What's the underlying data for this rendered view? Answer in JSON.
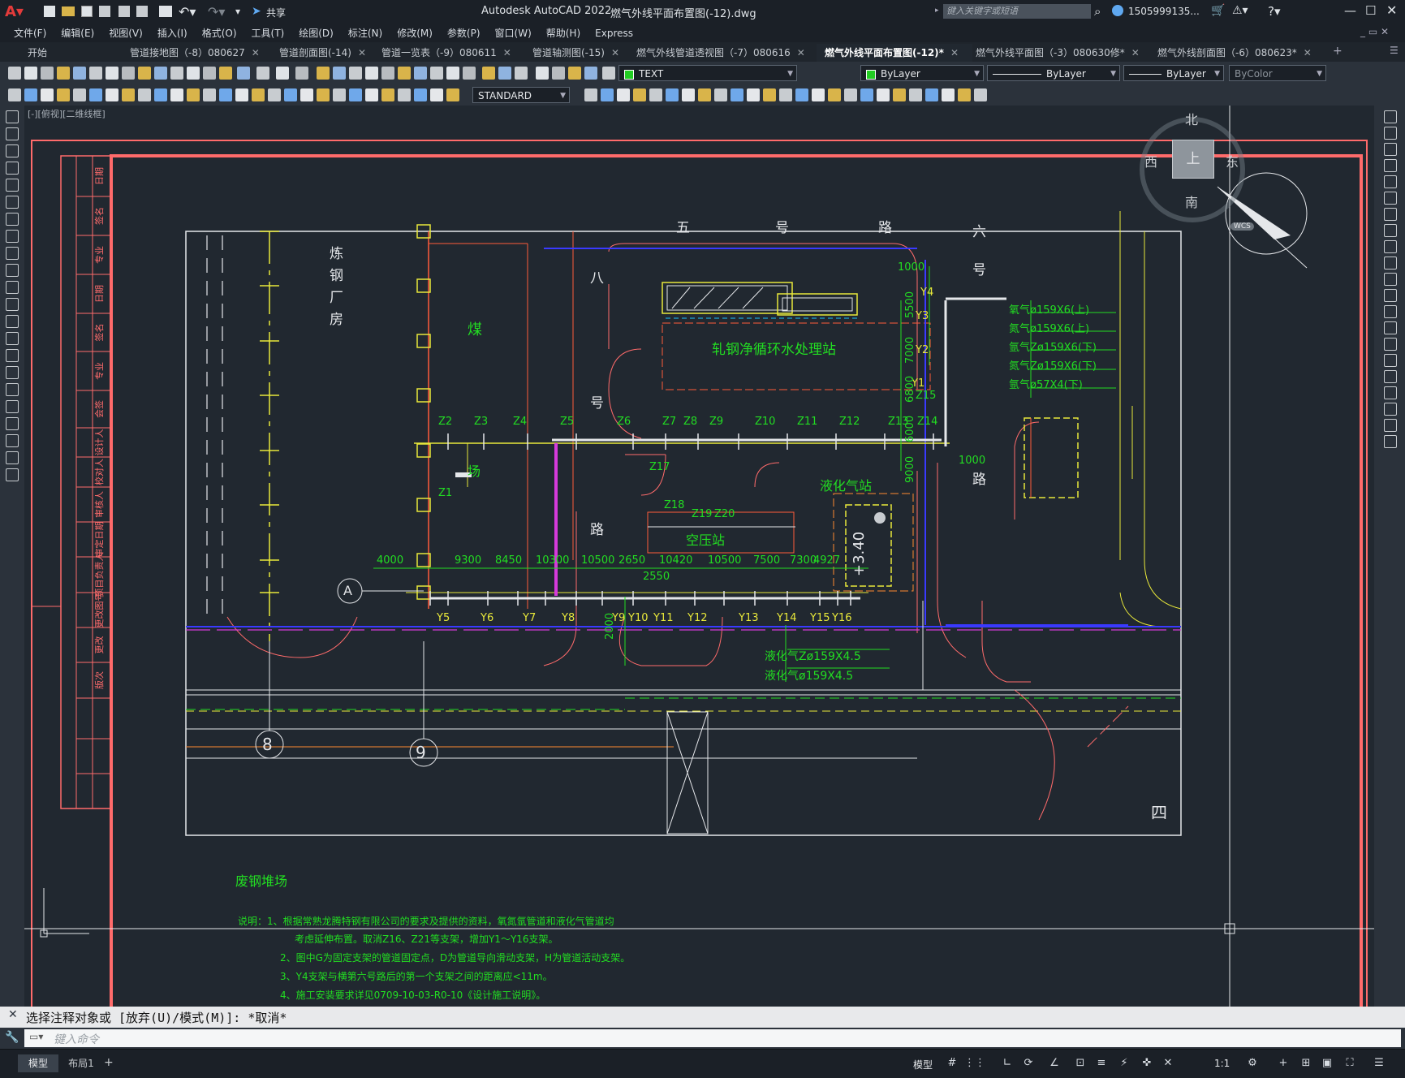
{
  "app": {
    "title": "Autodesk AutoCAD 2022",
    "file": "燃气外线平面布置图(-12).dwg",
    "search_placeholder": "键入关键字或短语",
    "user": "1505999135...",
    "share": "共享"
  },
  "menu": [
    "文件(F)",
    "编辑(E)",
    "视图(V)",
    "插入(I)",
    "格式(O)",
    "工具(T)",
    "绘图(D)",
    "标注(N)",
    "修改(M)",
    "参数(P)",
    "窗口(W)",
    "帮助(H)",
    "Express"
  ],
  "tabs": [
    {
      "label": "开始"
    },
    {
      "label": "管道接地图（-8）080627"
    },
    {
      "label": "管道剖面图(-14)"
    },
    {
      "label": "管道一览表（-9）080611"
    },
    {
      "label": "管道轴测图(-15)"
    },
    {
      "label": "燃气外线管道透视图（-7）080616"
    },
    {
      "label": "燃气外线平面布置图(-12)*"
    },
    {
      "label": "燃气外线平面图（-3）080630修*"
    },
    {
      "label": "燃气外线剖面图（-6）080623*"
    }
  ],
  "toolbar": {
    "layer": "TEXT",
    "color": "ByLayer",
    "linetype": "ByLayer",
    "lineweight": "ByLayer",
    "plotstyle": "ByColor",
    "textstyle": "STANDARD"
  },
  "viewport_label": "[-][俯视][二维线框]",
  "viewcube": {
    "north": "北",
    "south": "南",
    "east": "东",
    "west": "西",
    "top": "上",
    "wcs": "WCS"
  },
  "drawing": {
    "road_5": [
      "五",
      "号",
      "路"
    ],
    "road_6": [
      "六",
      "号",
      "路"
    ],
    "road_8": [
      "八",
      "号",
      "路"
    ],
    "road_4": "四",
    "building_steel": [
      "炼",
      "钢",
      "厂",
      "房"
    ],
    "coal": "煤",
    "yard": "场",
    "water_station": "轧钢净循环水处理站",
    "lpg_station": "液化气站",
    "air_station": "空压站",
    "scrap_yard": "废钢堆场",
    "elevation": "+3.40",
    "axis_a": "A",
    "axis_8": "8",
    "axis_9": "9",
    "z_labels": [
      "Z2",
      "Z3",
      "Z4",
      "Z5",
      "Z6",
      "Z7",
      "Z8",
      "Z9",
      "Z10",
      "Z11",
      "Z12",
      "Z13",
      "Z14"
    ],
    "z_misc": [
      "Z1",
      "Z15",
      "Z17",
      "Z18",
      "Z19",
      "Z20"
    ],
    "y_labels": [
      "Y5",
      "Y6",
      "Y7",
      "Y8",
      "Y9",
      "Y10",
      "Y11",
      "Y12",
      "Y13",
      "Y14",
      "Y15",
      "Y16"
    ],
    "y_misc": [
      "Y1",
      "Y2",
      "Y3",
      "Y4"
    ],
    "dims_bottom": [
      "4000",
      "9300",
      "8450",
      "10300",
      "10500",
      "2650",
      "10420",
      "10500",
      "7500",
      "7300",
      "4927"
    ],
    "dim_2550": "2550",
    "dim_2000": "2000",
    "dims_right": [
      "5500",
      "7000",
      "6800",
      "6000",
      "9000"
    ],
    "dim_1000a": "1000",
    "dim_1000b": "1000",
    "pipe_legend": [
      "氧气ø159X6(上)",
      "氮气ø159X6(上)",
      "氩气Zø159X6(下)",
      "氮气Zø159X6(下)",
      "氩气ø57X4(下)"
    ],
    "lpg_legend": [
      "液化气Zø159X4.5",
      "液化气ø159X4.5"
    ],
    "notes": [
      "说明：1、根据常熟龙腾特钢有限公司的要求及提供的资料，氧氮氩管道和液化气管道均",
      "考虑延伸布置。取消Z16、Z21等支架，增加Y1～Y16支架。",
      "2、图中G为固定支架的管道固定点，D为管道导向滑动支架，H为管道活动支架。",
      "3、Y4支架与横第六号路后的第一个支架之间的距离应<11m。",
      "4、施工安装要求详见0709-10-03-R0-10《设计施工说明》。"
    ],
    "title_block": [
      "日期",
      "签名",
      "专业",
      "日期",
      "签名",
      "专业",
      "会签",
      "设计人",
      "校对人",
      "审核人",
      "审定日期",
      "项目负责人",
      "更改图号",
      "更改",
      "版次"
    ]
  },
  "command": {
    "history": "选择注释对象或 [放弃(U)/模式(M)]: *取消*",
    "placeholder": "键入命令"
  },
  "status": {
    "tab_model": "模型",
    "tab_layout": "布局1",
    "model_label": "模型",
    "scale": "1:1"
  }
}
